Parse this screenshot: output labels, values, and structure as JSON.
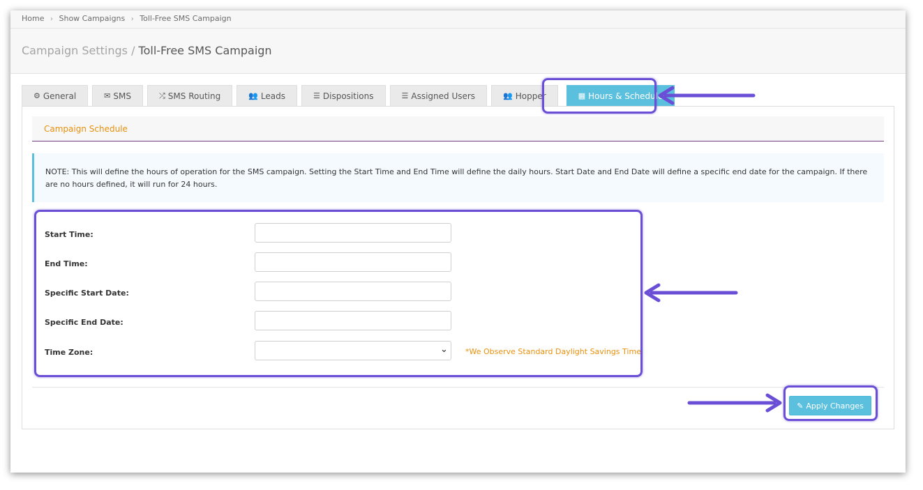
{
  "breadcrumb": {
    "home": "Home",
    "show_campaigns": "Show Campaigns",
    "current": "Toll-Free SMS Campaign",
    "separator": "›"
  },
  "header": {
    "section": "Campaign Settings",
    "slash": " / ",
    "title": "Toll-Free SMS Campaign"
  },
  "tabs": [
    {
      "label": "General",
      "icon": "gears-icon",
      "glyph": "⚙"
    },
    {
      "label": "SMS",
      "icon": "envelope-icon",
      "glyph": "✉"
    },
    {
      "label": "SMS Routing",
      "icon": "shuffle-icon",
      "glyph": "⤮"
    },
    {
      "label": "Leads",
      "icon": "users-icon",
      "glyph": "👥"
    },
    {
      "label": "Dispositions",
      "icon": "list-icon",
      "glyph": "☰"
    },
    {
      "label": "Assigned Users",
      "icon": "list-ordered-icon",
      "glyph": "☰"
    },
    {
      "label": "Hopper",
      "icon": "users-icon",
      "glyph": "👥"
    },
    {
      "label": "Hours & Schedule",
      "icon": "calendar-icon",
      "glyph": "▦",
      "active": true
    }
  ],
  "section_title": "Campaign Schedule",
  "note": "NOTE: This will define the hours of operation for the SMS campaign. Setting the Start Time and End Time will define the daily hours. Start Date and End Date will define a specific end date for the campaign. If there are no hours defined, it will run for 24 hours.",
  "form": {
    "start_time": {
      "label": "Start Time:",
      "value": ""
    },
    "end_time": {
      "label": "End Time:",
      "value": ""
    },
    "start_date": {
      "label": "Specific Start Date:",
      "value": ""
    },
    "end_date": {
      "label": "Specific End Date:",
      "value": ""
    },
    "time_zone": {
      "label": "Time Zone:",
      "value": ""
    },
    "tz_note": "*We Observe Standard Daylight Savings Time"
  },
  "apply_button": {
    "label": "Apply Changes",
    "icon": "edit-icon",
    "glyph": "✎"
  },
  "colors": {
    "accent_info": "#5bc0de",
    "highlight": "#6a4fd6",
    "warning_text": "#e8900c",
    "section_border": "#6f3d80"
  }
}
